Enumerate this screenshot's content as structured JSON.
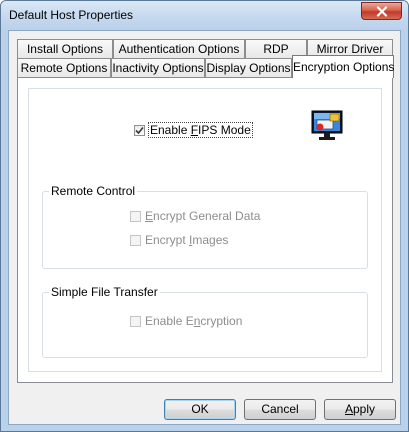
{
  "window": {
    "title": "Default Host Properties"
  },
  "tabs": {
    "row_back": [
      {
        "label": "Install Options"
      },
      {
        "label": "Authentication Options"
      },
      {
        "label": "RDP"
      },
      {
        "label": "Mirror Driver"
      }
    ],
    "row_front": [
      {
        "label": "Remote Options"
      },
      {
        "label": "Inactivity Options"
      },
      {
        "label": "Display Options"
      },
      {
        "label": "Encryption Options",
        "selected": true
      }
    ]
  },
  "encryption": {
    "fips": {
      "label_pre": "Enable ",
      "label_key": "F",
      "label_post": "IPS Mode",
      "checked": true
    },
    "remote_control": {
      "title": "Remote Control",
      "general": {
        "label_pre": "",
        "label_key": "E",
        "label_post": "ncrypt General Data",
        "checked": false,
        "enabled": false
      },
      "images": {
        "label_pre": "Encrypt ",
        "label_key": "I",
        "label_post": "mages",
        "checked": false,
        "enabled": false
      }
    },
    "file_transfer": {
      "title": "Simple File Transfer",
      "encryption": {
        "label_pre": "Enable E",
        "label_key": "n",
        "label_post": "cryption",
        "checked": false,
        "enabled": false
      }
    }
  },
  "buttons": {
    "ok": {
      "label": "OK"
    },
    "cancel": {
      "label": "Cancel"
    },
    "apply": {
      "label_key": "A",
      "label_post": "pply"
    }
  },
  "icons": {
    "close": "close-icon",
    "monitor": "monitor-lock-icon",
    "check": "checkmark-icon"
  },
  "colors": {
    "title_bar": "#c4d8ee",
    "close_button": "#c0392b",
    "dialog_bg": "#f0f0f0",
    "panel_bg": "#ffffff"
  }
}
